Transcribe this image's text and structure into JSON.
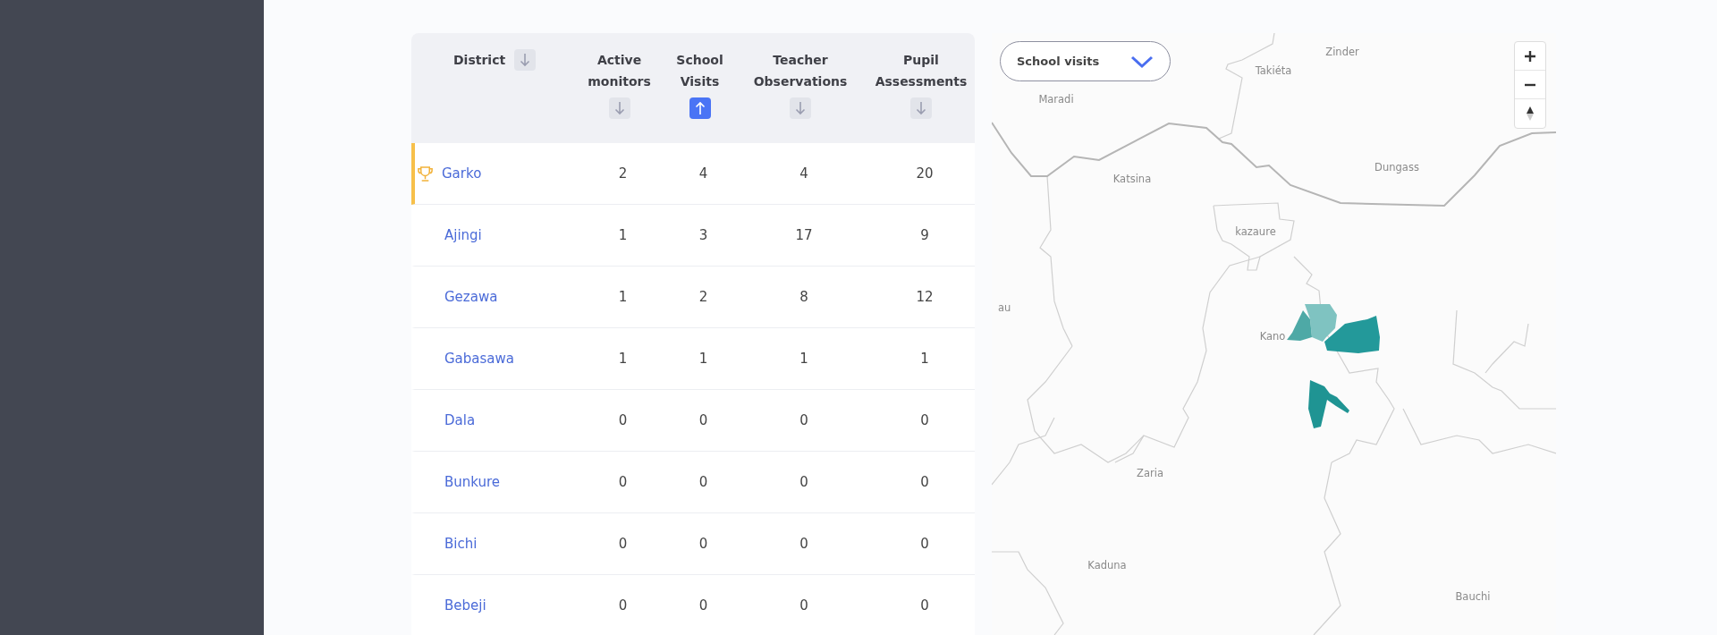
{
  "table": {
    "columns": [
      {
        "label": "District",
        "ascending": false,
        "selected": false
      },
      {
        "label": "Active monitors",
        "ascending": false,
        "selected": false
      },
      {
        "label": "School Visits",
        "ascending": true,
        "selected": true
      },
      {
        "label": "Teacher Observations",
        "ascending": false,
        "selected": false
      },
      {
        "label": "Pupil Assessments",
        "ascending": false,
        "selected": false
      }
    ],
    "rows": [
      {
        "district": "Garko",
        "leader": true,
        "values": [
          "2",
          "4",
          "4",
          "20"
        ]
      },
      {
        "district": "Ajingi",
        "leader": false,
        "values": [
          "1",
          "3",
          "17",
          "9"
        ]
      },
      {
        "district": "Gezawa",
        "leader": false,
        "values": [
          "1",
          "2",
          "8",
          "12"
        ]
      },
      {
        "district": "Gabasawa",
        "leader": false,
        "values": [
          "1",
          "1",
          "1",
          "1"
        ]
      },
      {
        "district": "Dala",
        "leader": false,
        "values": [
          "0",
          "0",
          "0",
          "0"
        ]
      },
      {
        "district": "Bunkure",
        "leader": false,
        "values": [
          "0",
          "0",
          "0",
          "0"
        ]
      },
      {
        "district": "Bichi",
        "leader": false,
        "values": [
          "0",
          "0",
          "0",
          "0"
        ]
      },
      {
        "district": "Bebeji",
        "leader": false,
        "values": [
          "0",
          "0",
          "0",
          "0"
        ]
      }
    ]
  },
  "map": {
    "metric": {
      "value": "School visits"
    },
    "labels": [
      "Zinder",
      "Takiéta",
      "Maradi",
      "Katsina",
      "Dungass",
      "kazaure",
      "au",
      "Kano",
      "Zaria",
      "Kaduna",
      "Bauchi"
    ]
  }
}
